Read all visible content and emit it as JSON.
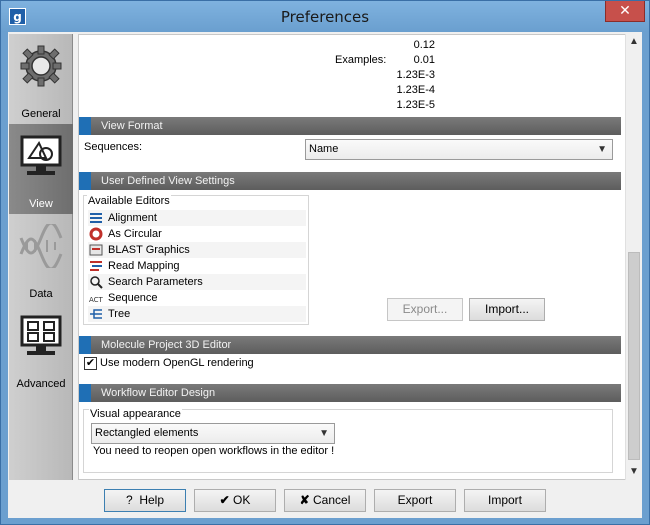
{
  "window": {
    "title": "Preferences",
    "app_icon_text": "g",
    "close_glyph": "✕"
  },
  "sidebar": {
    "items": [
      {
        "label": "General",
        "icon": "gear-icon"
      },
      {
        "label": "View",
        "icon": "view-icon",
        "selected": true
      },
      {
        "label": "Data",
        "icon": "dna-icon"
      },
      {
        "label": "Advanced",
        "icon": "advanced-icon"
      }
    ]
  },
  "number_format": {
    "examples_label": "Examples:",
    "values": [
      "0.12",
      "0.01",
      "1.23E-3",
      "1.23E-4",
      "1.23E-5"
    ]
  },
  "view_format": {
    "header": "View Format",
    "sequences_label": "Sequences:",
    "sequences_value": "Name"
  },
  "user_defined": {
    "header": "User Defined View Settings",
    "available_label": "Available Editors",
    "editors": [
      {
        "label": "Alignment",
        "icon": "alignment-icon"
      },
      {
        "label": "As Circular",
        "icon": "circular-icon"
      },
      {
        "label": "BLAST Graphics",
        "icon": "blast-icon"
      },
      {
        "label": "Read Mapping",
        "icon": "read-mapping-icon"
      },
      {
        "label": "Search Parameters",
        "icon": "search-icon"
      },
      {
        "label": "Sequence",
        "icon": "sequence-icon"
      },
      {
        "label": "Tree",
        "icon": "tree-icon"
      }
    ],
    "export_label": "Export...",
    "import_label": "Import..."
  },
  "molecule": {
    "header": "Molecule Project 3D Editor",
    "opengl_label": "Use modern OpenGL rendering",
    "opengl_checked": true
  },
  "workflow": {
    "header": "Workflow Editor Design",
    "visual_label": "Visual appearance",
    "visual_value": "Rectangled elements",
    "note": "You need to reopen open workflows in the editor !"
  },
  "footer": {
    "help_label": "Help",
    "ok_label": "OK",
    "cancel_label": "Cancel",
    "export_label": "Export",
    "import_label": "Import"
  },
  "colors": {
    "accent": "#1f6fb5",
    "title_bar": "#6b9fcf",
    "section_header": "#6a6a6a"
  }
}
